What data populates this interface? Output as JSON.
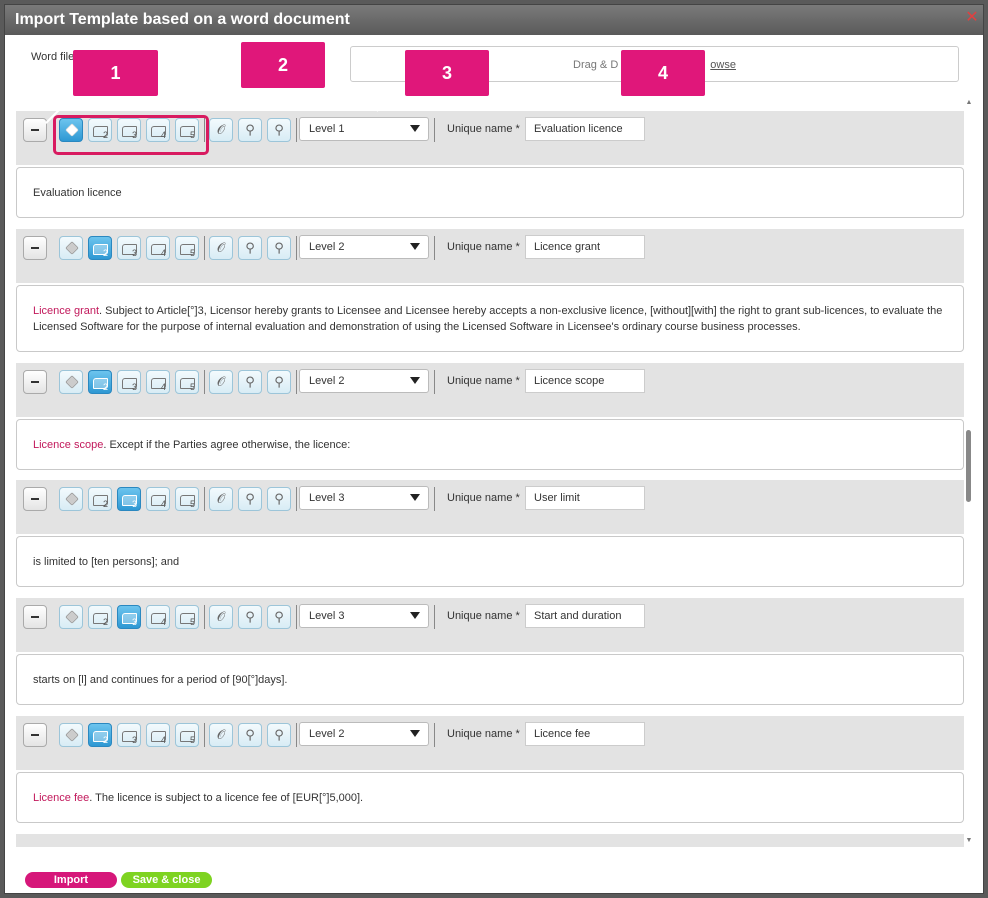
{
  "dialog": {
    "title": "Import Template based on a word document",
    "close_symbol": "✕"
  },
  "upload": {
    "word_file_label": "Word file",
    "dropzone_text": "Drag & D",
    "browse_text": "owse"
  },
  "callouts": [
    "1",
    "2",
    "3",
    "4"
  ],
  "toolbar": {
    "unique_name_label": "Unique name *",
    "tool_icons": [
      "article-icon",
      "level-2-icon",
      "level-3-icon",
      "level-4-icon",
      "level-5-icon",
      "attachment-icon",
      "pipette-icon",
      "pipette-2-icon"
    ],
    "tool_numbers": [
      "2",
      "3",
      "4",
      "5"
    ]
  },
  "blocks": [
    {
      "level": "Level 1",
      "unique_name": "Evaluation licence",
      "active_tool": 0,
      "text_highlight": "",
      "text": "Evaluation licence"
    },
    {
      "level": "Level 2",
      "unique_name": "Licence grant",
      "active_tool": 1,
      "text_highlight": "Licence grant",
      "text": ". Subject to Article[°]3, Licensor hereby grants to Licensee and Licensee hereby accepts a non-exclusive licence, [without][with] the right to grant sub-licences, to evaluate the Licensed Software for the purpose of internal evaluation and demonstration of using the Licensed Software in Licensee's ordinary course business processes."
    },
    {
      "level": "Level 2",
      "unique_name": "Licence scope",
      "active_tool": 1,
      "text_highlight": "Licence scope",
      "text": ". Except if the Parties agree otherwise, the licence:"
    },
    {
      "level": "Level 3",
      "unique_name": "User limit",
      "active_tool": 2,
      "text_highlight": "",
      "text": "is limited to [ten persons]; and"
    },
    {
      "level": "Level 3",
      "unique_name": "Start and duration",
      "active_tool": 2,
      "text_highlight": "",
      "text": "starts on [l] and continues for a period of [90[°]days]."
    },
    {
      "level": "Level 2",
      "unique_name": "Licence fee",
      "active_tool": 1,
      "text_highlight": "Licence fee",
      "text": ". The licence is subject to a licence fee of [EUR[°]5,000]."
    }
  ],
  "footer": {
    "import_label": "Import",
    "save_close_label": "Save & close"
  },
  "colors": {
    "accent": "#e0177a",
    "save": "#7ed321",
    "tool_active": "#2e98d3"
  }
}
